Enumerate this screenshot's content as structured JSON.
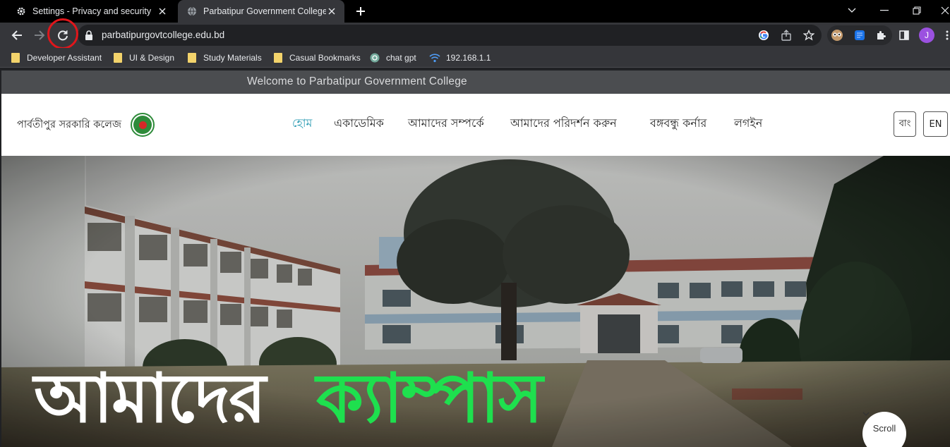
{
  "browser": {
    "tabs": [
      {
        "title": "Settings - Privacy and security",
        "icon": "gear-icon",
        "active": false
      },
      {
        "title": "Parbatipur Government College",
        "icon": "globe-icon",
        "active": true
      }
    ],
    "url": "parbatipurgovtcollege.edu.bd",
    "profile_initial": "J",
    "bookmarks": [
      {
        "label": "Developer Assistant",
        "icon": "folder-icon"
      },
      {
        "label": "UI & Design",
        "icon": "folder-icon"
      },
      {
        "label": "Study Materials",
        "icon": "folder-icon"
      },
      {
        "label": "Casual Bookmarks",
        "icon": "folder-icon"
      },
      {
        "label": "chat gpt",
        "icon": "chatgpt-icon"
      },
      {
        "label": "192.168.1.1",
        "icon": "wifi-icon"
      }
    ]
  },
  "site": {
    "welcome": "Welcome to Parbatipur Government College",
    "brand": "পার্বতীপুর সরকারি কলেজ",
    "nav": [
      {
        "label": "হোম",
        "active": true
      },
      {
        "label": "একাডেমিক",
        "active": false
      },
      {
        "label": "আমাদের সম্পর্কে",
        "active": false
      },
      {
        "label": "আমাদের পরিদর্শন করুন",
        "active": false
      },
      {
        "label": "বঙ্গবন্ধু কর্নার",
        "active": false
      },
      {
        "label": "লগইন",
        "active": false
      }
    ],
    "lang_bn": "বাং",
    "lang_en": "EN",
    "hero_word1": "আমাদের",
    "hero_word2": "ক্যাম্পাস",
    "scroll_label": "Scroll"
  },
  "colors": {
    "nav_active": "#2b9bb3",
    "hero_highlight": "#1ee04e",
    "annotation_ring": "#e0161b"
  }
}
